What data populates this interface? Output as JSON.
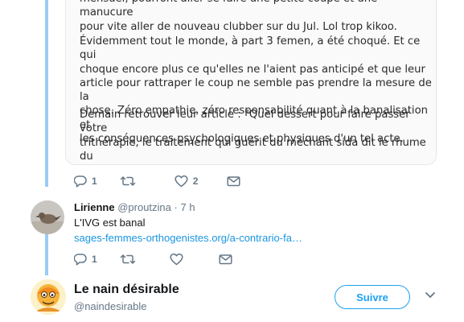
{
  "quoted_article": {
    "paragraphs": [
      "mensuel, pourront aller se faire une petite coupe et une manucure\npour vite aller de nouveau clubber sur du Jul. Lol trop kikoo.",
      "Évidemment tout le monde, à part 3 femen, a été choqué. Et ce qui\nchoque encore plus ce qu'elles ne l'aient pas anticipé et que leur\narticle pour rattraper le coup ne semble pas prendre la mesure de la\nchose. Zéro empathie, zéro responsabilité quant à la banalisation et\nles conséquences psychologiques et physiques d'un tel acte.",
      "Demain retrouver leur article : \"Quel dessert pour faire passer votre\ntrithérapie, le traitement qui guérit du méchant sida dit le rhume du\nsexe?\""
    ]
  },
  "tweet1_actions": {
    "reply_count": "1",
    "retweet_count": "",
    "like_count": "2"
  },
  "reply_tweet": {
    "name": "Lirienne",
    "handle": "@proutzina",
    "separator": "·",
    "time": "7 h",
    "text": "L'IVG est banal",
    "link": "sages-femmes-orthogenistes.org/a-contrario-fa…",
    "reply_count": "1",
    "retweet_count": "",
    "like_count": ""
  },
  "suggested_user": {
    "name": "Le nain désirable",
    "handle": "@naindesirable",
    "follow_label": "Suivre"
  },
  "icons": {
    "reply": "reply-icon",
    "retweet": "retweet-icon",
    "like": "heart-icon",
    "dm": "envelope-icon",
    "more": "chevron-down-icon"
  },
  "colors": {
    "thread_line": "#99ccf5",
    "link": "#1b95e0",
    "follow": "#1da1f2",
    "muted": "#657786"
  }
}
